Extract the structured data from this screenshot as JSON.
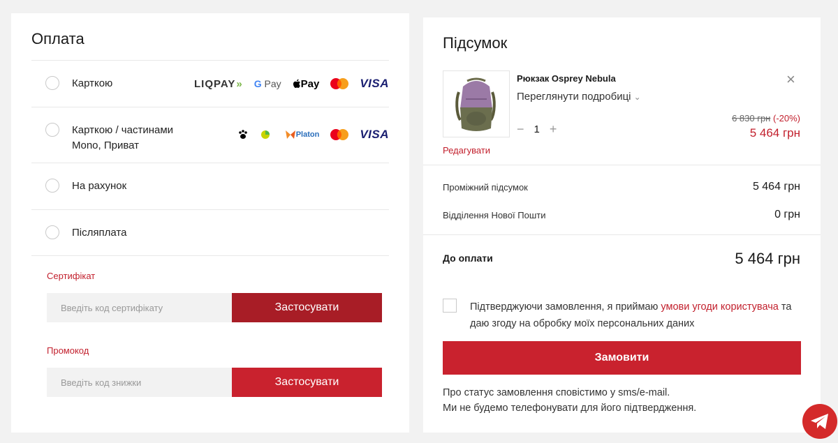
{
  "payment": {
    "title": "Оплата",
    "options": [
      {
        "label": "Карткою"
      },
      {
        "label_line1": "Карткою / частинами",
        "label_line2": "Mono, Приват"
      },
      {
        "label": "На рахунок"
      },
      {
        "label": "Післяплата"
      }
    ],
    "logos_row1": {
      "liqpay": "LIQPAY",
      "gpay_g": "G",
      "gpay_pay": "Pay",
      "apay": "Pay",
      "visa": "VISA"
    },
    "logos_row2": {
      "platon": "Platon",
      "visa": "VISA"
    }
  },
  "certificate": {
    "label": "Сертифікат",
    "placeholder": "Введіть код сертифікату",
    "button": "Застосувати"
  },
  "promo": {
    "label": "Промокод",
    "placeholder": "Введіть код знижки",
    "button": "Застосувати"
  },
  "summary": {
    "title": "Підсумок",
    "product": {
      "name": "Рюкзак Osprey Nebula",
      "details": "Переглянути подробиці",
      "quantity": "1",
      "old_price": "6 830 грн",
      "discount": "(-20%)",
      "price": "5 464 грн",
      "edit": "Редагувати"
    },
    "subtotal_label": "Проміжний підсумок",
    "subtotal_value": "5 464 грн",
    "shipping_label": "Відділення Нової Пошти",
    "shipping_value": "0 грн",
    "total_label": "До оплати",
    "total_value": "5 464 грн",
    "consent_part1": "Підтверджуючи замовлення, я приймаю ",
    "consent_link": "умови угоди користувача",
    "consent_part2": " та даю згоду на обробку моїх персональних даних",
    "order_button": "Замовити",
    "info_line1": "Про статус замовлення сповістимо у sms/e-mail.",
    "info_line2": "Ми не будемо телефонувати для його підтвердження."
  },
  "colors": {
    "accent": "#c9222e",
    "accent_dark": "#a81d26",
    "background": "#f2f2f2"
  }
}
